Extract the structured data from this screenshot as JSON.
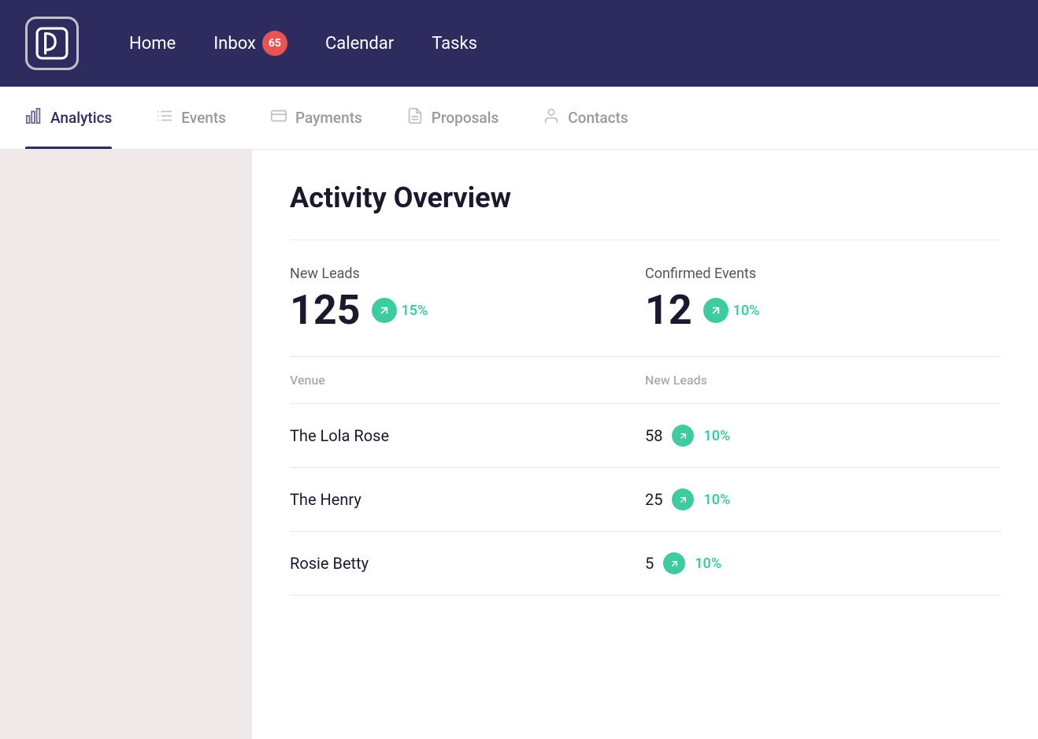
{
  "app": {
    "logo_label": "P"
  },
  "top_nav": {
    "items": [
      {
        "label": "Home",
        "badge": null
      },
      {
        "label": "Inbox",
        "badge": "65"
      },
      {
        "label": "Calendar",
        "badge": null
      },
      {
        "label": "Tasks",
        "badge": null
      }
    ]
  },
  "sub_nav": {
    "items": [
      {
        "label": "Analytics",
        "active": true,
        "icon": "bar-chart"
      },
      {
        "label": "Events",
        "active": false,
        "icon": "list"
      },
      {
        "label": "Payments",
        "active": false,
        "icon": "credit-card"
      },
      {
        "label": "Proposals",
        "active": false,
        "icon": "document"
      },
      {
        "label": "Contacts",
        "active": false,
        "icon": "person"
      }
    ]
  },
  "page": {
    "title": "Activity Overview",
    "stats": [
      {
        "label": "New Leads",
        "value": "125",
        "pct": "15%"
      },
      {
        "label": "Confirmed Events",
        "value": "12",
        "pct": "10%"
      }
    ],
    "table": {
      "col1_header": "Venue",
      "col2_header": "New Leads",
      "rows": [
        {
          "venue": "The Lola Rose",
          "leads": "58",
          "pct": "10%"
        },
        {
          "venue": "The Henry",
          "leads": "25",
          "pct": "10%"
        },
        {
          "venue": "Rosie Betty",
          "leads": "5",
          "pct": "10%"
        }
      ]
    }
  }
}
